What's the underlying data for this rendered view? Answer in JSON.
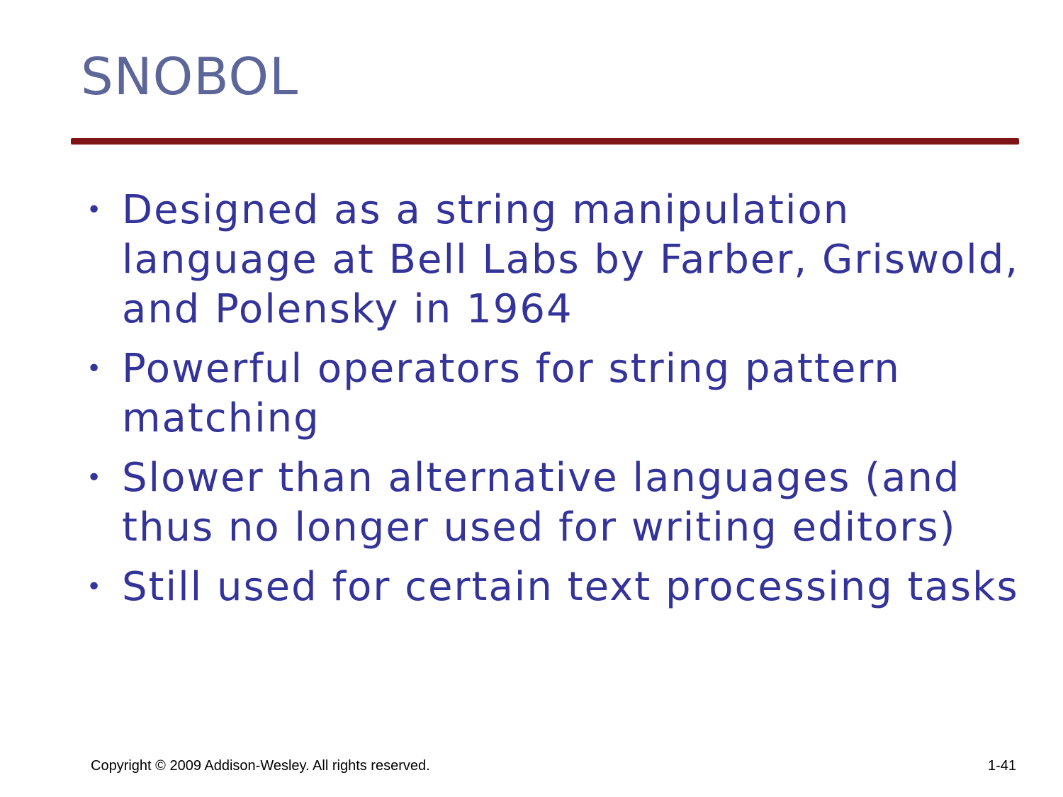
{
  "slide": {
    "title": "SNOBOL",
    "bullets": [
      "Designed as a string manipulation language at Bell Labs by Farber, Griswold, and Polensky in 1964",
      "Powerful operators for string pattern matching",
      "Slower than alternative languages (and thus no longer used for writing editors)",
      "Still used for certain text processing tasks"
    ],
    "bullet_symbol": "•"
  },
  "footer": {
    "copyright": "Copyright © 2009 Addison-Wesley. All rights reserved.",
    "page_number": "1-41"
  },
  "colors": {
    "title": "#5c6699",
    "rule": "#7f1416",
    "body_text": "#333399",
    "footer_text": "#000000"
  }
}
